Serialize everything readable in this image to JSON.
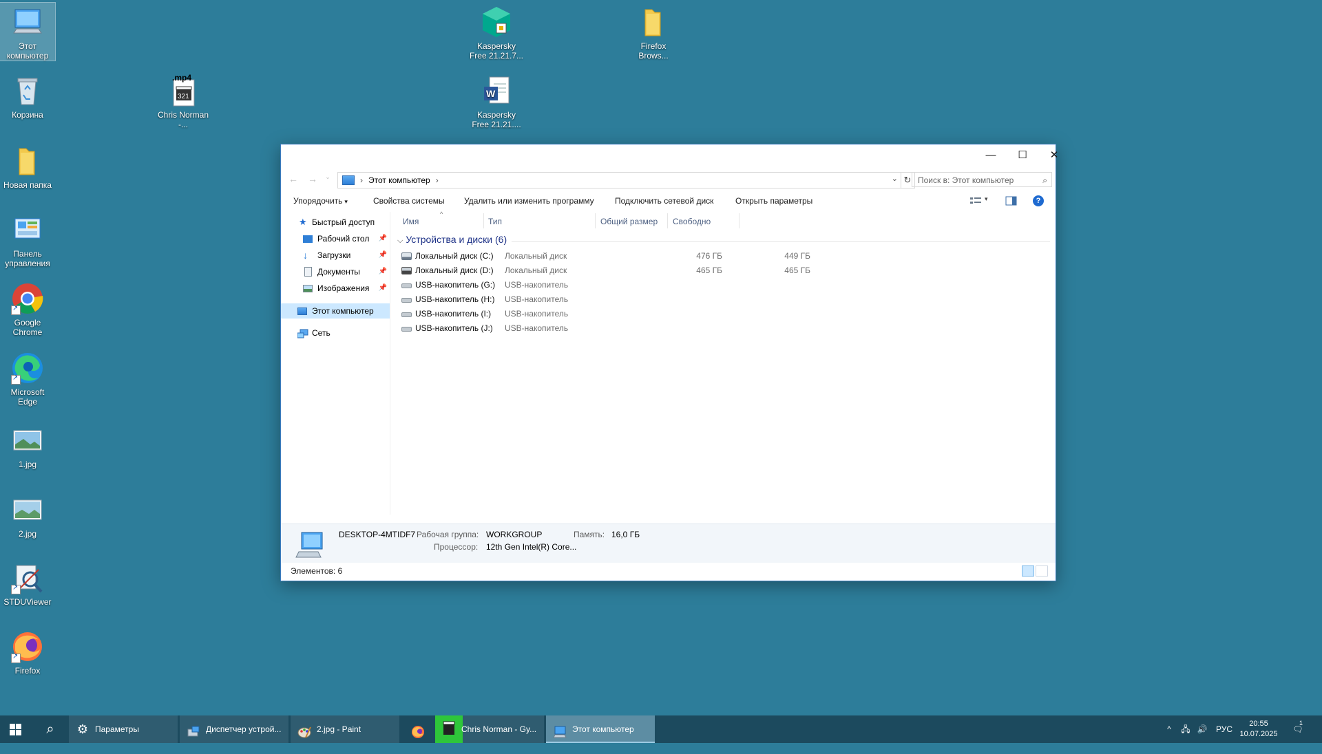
{
  "desktop": {
    "icons": [
      {
        "label": "Этот компьютер"
      },
      {
        "label": "Корзина"
      },
      {
        "label": "Новая папка"
      },
      {
        "label": "Панель управления"
      },
      {
        "label": "Google Chrome"
      },
      {
        "label": "Microsoft Edge"
      },
      {
        "label": "1.jpg"
      },
      {
        "label": "2.jpg"
      },
      {
        "label": "STDUViewer"
      },
      {
        "label": "Firefox"
      },
      {
        "label": "Chris Norman -...",
        "badge": ".mp4",
        "badge_num": "321"
      },
      {
        "label": "Kaspersky Free 21.21.7..."
      },
      {
        "label": "Kaspersky Free 21.21...."
      },
      {
        "label": "Firefox Brows..."
      }
    ]
  },
  "explorer": {
    "window_controls": {
      "minimize": "—",
      "maximize": "☐",
      "close": "✕"
    },
    "address": {
      "path": "Этот компьютер",
      "separator": "›"
    },
    "search": {
      "placeholder": "Поиск в: Этот компьютер"
    },
    "commands": [
      {
        "label": "Упорядочить",
        "caret": "▾"
      },
      {
        "label": "Свойства системы"
      },
      {
        "label": "Удалить или изменить программу"
      },
      {
        "label": "Подключить сетевой диск"
      },
      {
        "label": "Открыть параметры"
      }
    ],
    "nav": [
      {
        "label": "Быстрый доступ"
      },
      {
        "label": "Рабочий стол",
        "pinned": true
      },
      {
        "label": "Загрузки",
        "pinned": true
      },
      {
        "label": "Документы",
        "pinned": true
      },
      {
        "label": "Изображения",
        "pinned": true
      },
      {
        "label": "Этот компьютер",
        "active": true
      },
      {
        "label": "Сеть"
      }
    ],
    "columns": [
      "Имя",
      "Тип",
      "Общий размер",
      "Свободно"
    ],
    "group": {
      "label": "Устройства и диски (6)"
    },
    "drives": [
      {
        "name": "Локальный диск (C:)",
        "type": "Локальный диск",
        "total": "476 ГБ",
        "free": "449 ГБ"
      },
      {
        "name": "Локальный диск (D:)",
        "type": "Локальный диск",
        "total": "465 ГБ",
        "free": "465 ГБ"
      },
      {
        "name": "USB-накопитель (G:)",
        "type": "USB-накопитель",
        "total": "",
        "free": ""
      },
      {
        "name": "USB-накопитель (H:)",
        "type": "USB-накопитель",
        "total": "",
        "free": ""
      },
      {
        "name": "USB-накопитель (I:)",
        "type": "USB-накопитель",
        "total": "",
        "free": ""
      },
      {
        "name": "USB-накопитель (J:)",
        "type": "USB-накопитель",
        "total": "",
        "free": ""
      }
    ],
    "details": {
      "computer_name": "DESKTOP-4MTIDF7",
      "workgroup_label": "Рабочая группа:",
      "workgroup_value": "WORKGROUP",
      "memory_label": "Память:",
      "memory_value": "16,0 ГБ",
      "cpu_label": "Процессор:",
      "cpu_value": "12th Gen Intel(R) Core..."
    },
    "status": {
      "items_count": "Элементов: 6"
    }
  },
  "taskbar": {
    "tasks": [
      {
        "label": "Параметры"
      },
      {
        "label": "Диспетчер устрой..."
      },
      {
        "label": "2.jpg - Paint"
      },
      {
        "label": ""
      },
      {
        "label": "Chris Norman - Gy..."
      },
      {
        "label": "Этот компьютер",
        "active": true
      }
    ],
    "tray": {
      "language": "РУС",
      "time": "20:55",
      "date": "10.07.2025",
      "notifications": "1"
    }
  },
  "colors": {
    "desktop": "#2d7d9a",
    "taskbar": "#1c4a5e",
    "accent": "#1e6ad0",
    "nav_active": "#cce8ff"
  }
}
